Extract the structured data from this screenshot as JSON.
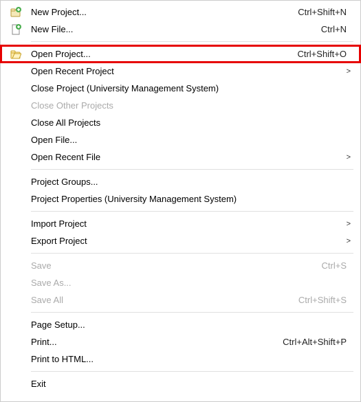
{
  "menu": {
    "items": [
      {
        "label": "New Project...",
        "shortcut": "Ctrl+Shift+N",
        "icon": "new-project"
      },
      {
        "label": "New File...",
        "shortcut": "Ctrl+N",
        "icon": "new-file"
      },
      {
        "sep": true
      },
      {
        "label": "Open Project...",
        "shortcut": "Ctrl+Shift+O",
        "icon": "open-project",
        "highlight": true
      },
      {
        "label": "Open Recent Project",
        "submenu": true
      },
      {
        "label": "Close Project (University Management System)"
      },
      {
        "label": "Close Other Projects",
        "disabled": true
      },
      {
        "label": "Close All Projects"
      },
      {
        "label": "Open File..."
      },
      {
        "label": "Open Recent File",
        "submenu": true
      },
      {
        "sep": true
      },
      {
        "label": "Project Groups..."
      },
      {
        "label": "Project Properties (University Management System)"
      },
      {
        "sep": true
      },
      {
        "label": "Import Project",
        "submenu": true
      },
      {
        "label": "Export Project",
        "submenu": true
      },
      {
        "sep": true
      },
      {
        "label": "Save",
        "shortcut": "Ctrl+S",
        "disabled": true
      },
      {
        "label": "Save As...",
        "disabled": true
      },
      {
        "label": "Save All",
        "shortcut": "Ctrl+Shift+S",
        "disabled": true
      },
      {
        "sep": true
      },
      {
        "label": "Page Setup..."
      },
      {
        "label": "Print...",
        "shortcut": "Ctrl+Alt+Shift+P"
      },
      {
        "label": "Print to HTML..."
      },
      {
        "sep": true
      },
      {
        "label": "Exit"
      }
    ]
  }
}
